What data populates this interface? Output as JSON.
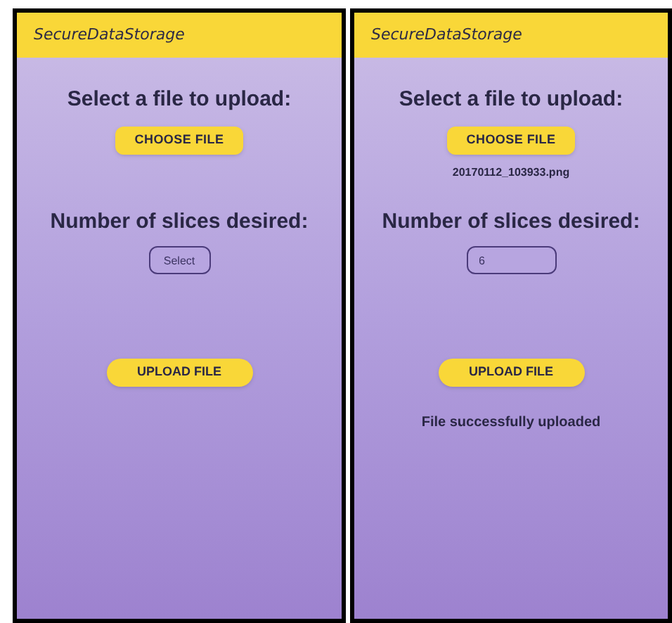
{
  "screens": [
    {
      "app_title": "SecureDataStorage",
      "upload_heading": "Select a file to upload:",
      "choose_button": "CHOOSE FILE",
      "slices_heading": "Number of slices desired:",
      "slices_field": {
        "placeholder": "Select"
      },
      "upload_button": "UPLOAD FILE"
    },
    {
      "app_title": "SecureDataStorage",
      "upload_heading": "Select a file to upload:",
      "choose_button": "CHOOSE FILE",
      "file_name": "20170112_103933.png",
      "slices_heading": "Number of slices desired:",
      "slices_field": {
        "value": "6"
      },
      "upload_button": "UPLOAD FILE",
      "status": "File successfully uploaded"
    }
  ]
}
